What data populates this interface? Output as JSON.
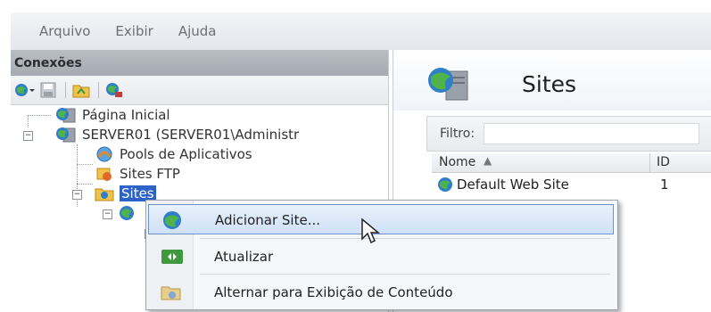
{
  "menubar": {
    "items": [
      "Arquivo",
      "Exibir",
      "Ajuda"
    ]
  },
  "connections": {
    "title": "Conexões",
    "toolbar": [
      "globe-dropdown-icon",
      "save-icon",
      "folder-icon",
      "connect-icon"
    ],
    "tree": {
      "start_page": "Página Inicial",
      "server": "SERVER01 (SERVER01\\Administr",
      "app_pools": "Pools de Aplicativos",
      "ftp_sites": "Sites FTP",
      "sites": "Sites"
    }
  },
  "main": {
    "title": "Sites",
    "filter_label": "Filtro:",
    "columns": {
      "name": "Nome",
      "id": "ID"
    },
    "rows": [
      {
        "name": "Default Web Site",
        "id": "1"
      }
    ]
  },
  "context_menu": {
    "items": [
      {
        "label": "Adicionar Site...",
        "icon": "add-site-globe-icon",
        "highlighted": true
      },
      {
        "label": "Atualizar",
        "icon": "refresh-icon",
        "highlighted": false
      },
      {
        "label": "Alternar para Exibição de Conteúdo",
        "icon": "content-view-icon",
        "highlighted": false
      }
    ]
  },
  "colors": {
    "selection": "#2d63c9",
    "menu_highlight": "#cfe0f7",
    "header": "#a6abb3"
  }
}
